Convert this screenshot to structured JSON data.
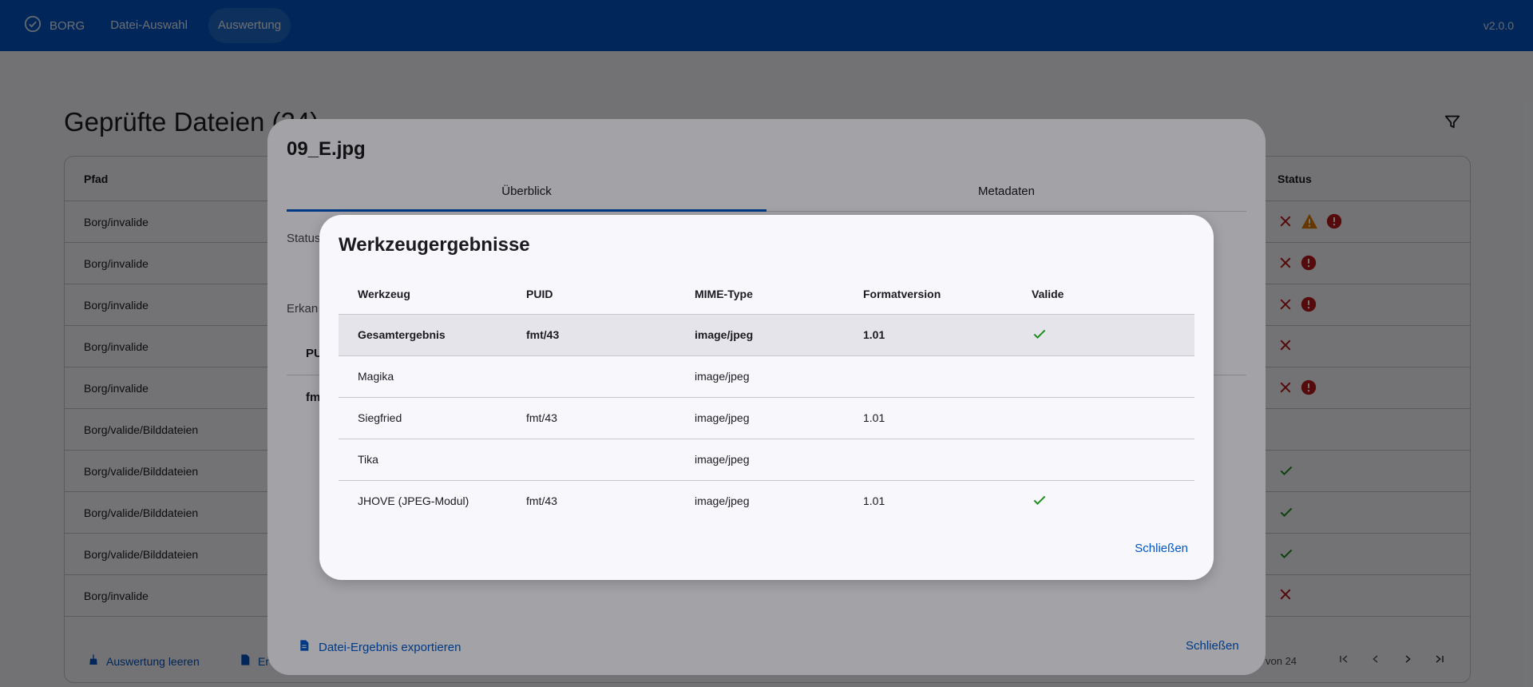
{
  "topbar": {
    "brand": "BORG",
    "nav": [
      "Datei-Auswahl",
      "Auswertung"
    ],
    "active_nav": "Auswertung",
    "version": "v2.0.0"
  },
  "background": {
    "title": "Geprüfte Dateien (24)",
    "columns": {
      "path": "Pfad",
      "status": "Status"
    },
    "rows": [
      {
        "path": "Borg/invalide",
        "icons": [
          "error-x",
          "warning",
          "alert-circle"
        ]
      },
      {
        "path": "Borg/invalide",
        "icons": [
          "error-x",
          "alert-circle"
        ]
      },
      {
        "path": "Borg/invalide",
        "icons": [
          "error-x",
          "alert-circle"
        ]
      },
      {
        "path": "Borg/invalide",
        "icons": [
          "error-x"
        ]
      },
      {
        "path": "Borg/invalide",
        "icons": [
          "error-x",
          "alert-circle"
        ]
      },
      {
        "path": "Borg/valide/Bilddateien",
        "icons": []
      },
      {
        "path": "Borg/valide/Bilddateien",
        "icons": [
          "check"
        ]
      },
      {
        "path": "Borg/valide/Bilddateien",
        "icons": [
          "check"
        ]
      },
      {
        "path": "Borg/valide/Bilddateien",
        "icons": [
          "check"
        ]
      },
      {
        "path": "Borg/invalide",
        "icons": [
          "error-x"
        ]
      }
    ],
    "footer": {
      "clear_button": "Auswertung leeren",
      "export_fragment": "Er",
      "range": "von 24"
    }
  },
  "file_dialog": {
    "title": "09_E.jpg",
    "tabs": [
      "Überblick",
      "Metadaten"
    ],
    "active_tab": "Überblick",
    "fragments": {
      "status": "Status",
      "erkannt": "Erkan",
      "puid": "PU",
      "fmt": "fm"
    },
    "export_button": "Datei-Ergebnis exportieren",
    "close_button": "Schließen"
  },
  "tool_dialog": {
    "title": "Werkzeugergebnisse",
    "columns": [
      "Werkzeug",
      "PUID",
      "MIME-Type",
      "Formatversion",
      "Valide"
    ],
    "rows": [
      {
        "tool": "Gesamtergebnis",
        "puid": "fmt/43",
        "mime": "image/jpeg",
        "version": "1.01",
        "valid": true,
        "summary": true
      },
      {
        "tool": "Magika",
        "puid": "",
        "mime": "image/jpeg",
        "version": "",
        "valid": false,
        "summary": false
      },
      {
        "tool": "Siegfried",
        "puid": "fmt/43",
        "mime": "image/jpeg",
        "version": "1.01",
        "valid": false,
        "summary": false
      },
      {
        "tool": "Tika",
        "puid": "",
        "mime": "image/jpeg",
        "version": "",
        "valid": false,
        "summary": false
      },
      {
        "tool": "JHOVE (JPEG-Modul)",
        "puid": "fmt/43",
        "mime": "image/jpeg",
        "version": "1.01",
        "valid": true,
        "summary": false
      }
    ],
    "close_button": "Schließen"
  },
  "colors": {
    "primary": "#0055c4",
    "error": "#ba1a1a",
    "warning": "#e07a00",
    "success": "#1e8e1e"
  }
}
